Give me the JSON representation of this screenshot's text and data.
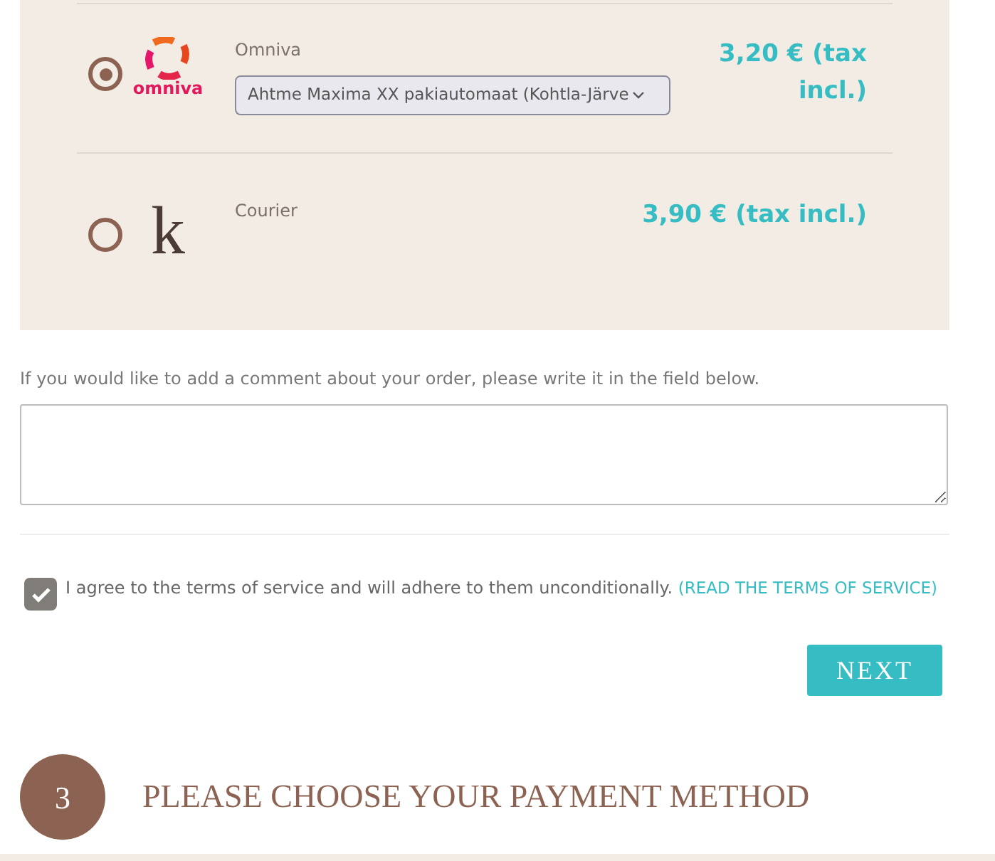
{
  "shipping_options": [
    {
      "kind": "omniva",
      "selected": true,
      "logo_text": "omniva",
      "name": "Omniva",
      "dropdown": "Ahtme Maxima XX pakiautomaat (Kohtla-Järve",
      "price": "3,20 € (tax incl.)"
    },
    {
      "kind": "letter",
      "selected": false,
      "logo_text": "k",
      "name": "Courier",
      "price": "3,90 € (tax incl.)"
    }
  ],
  "comment": {
    "label": "If you would like to add a comment about your order, please write it in the field below."
  },
  "terms": {
    "checked": true,
    "text": "I agree to the terms of service and will adhere to them unconditionally.",
    "link": "(READ THE TERMS OF SERVICE)"
  },
  "next_button": "NEXT",
  "next_step": {
    "number": "3",
    "title": "PLEASE CHOOSE YOUR PAYMENT METHOD"
  }
}
